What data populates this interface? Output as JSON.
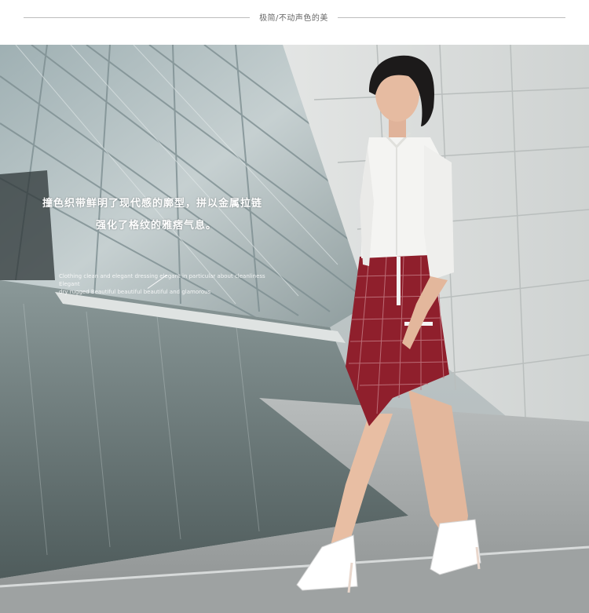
{
  "header": {
    "tagline": "极简/不动声色的美"
  },
  "photo": {
    "description_icon": "fashion-photo",
    "caption": {
      "line1": "撞色织带鲜明了现代感的廓型，拼以金属拉链",
      "line2": "强化了格纹的雅痞气息。",
      "english_line1": "Clothing clean and elegant dressing elegant in particular about cleanliness Elegant",
      "english_line2": "dry rugged Beautiful beautiful beautiful and glamorous"
    }
  },
  "colors": {
    "skirt": "#8f1f2c",
    "shirt": "#f4f4f2",
    "wall": "#d9dcdb",
    "water": "#5e6b6b"
  }
}
